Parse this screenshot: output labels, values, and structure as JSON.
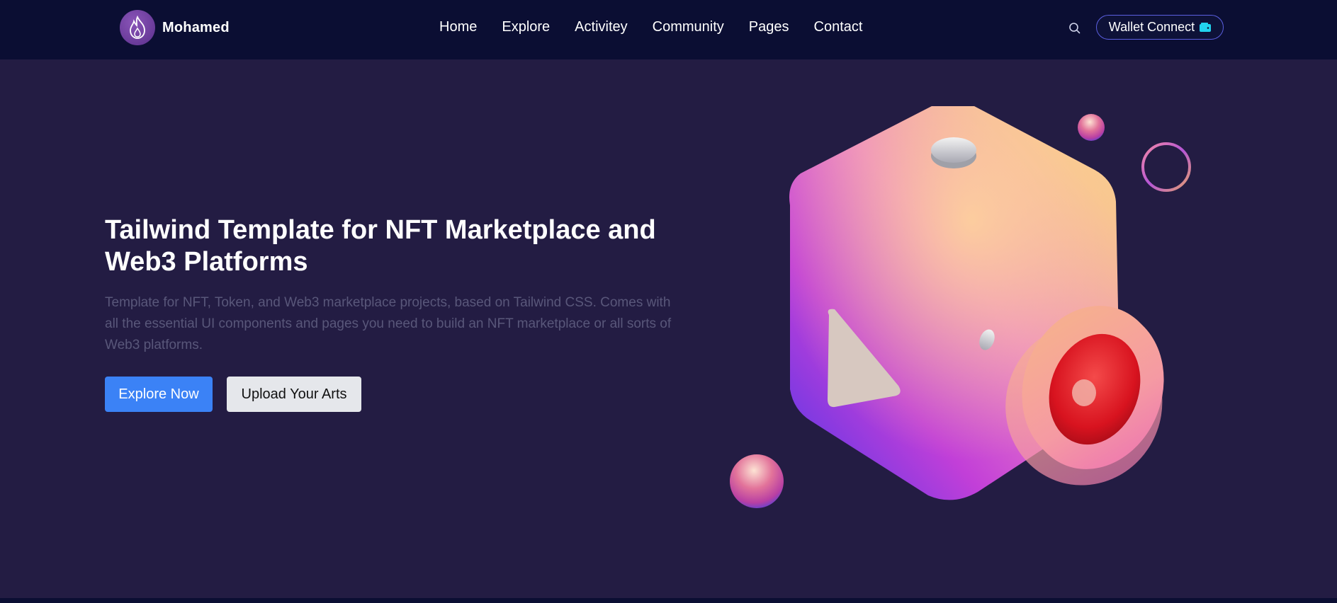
{
  "brand": {
    "name": "Mohamed",
    "logo_icon": "flame-icon"
  },
  "nav": {
    "links": [
      "Home",
      "Explore",
      "Activitey",
      "Community",
      "Pages",
      "Contact"
    ],
    "search_icon": "search-icon",
    "wallet_button": {
      "label": "Wallet Connect",
      "icon": "wallet-icon"
    }
  },
  "hero": {
    "title": "Tailwind Template for NFT Marketplace and Web3 Platforms",
    "description": "Template for NFT, Token, and Web3 marketplace projects, based on Tailwind CSS. Comes with all the essential UI components and pages you need to build an NFT marketplace or all sorts of Web3 platforms.",
    "primary_button": "Explore Now",
    "secondary_button": "Upload Your Arts",
    "illustration": "3d-cube-speaker-illustration"
  },
  "colors": {
    "navbar_bg": "#0b0e33",
    "page_bg": "#231c43",
    "primary": "#3b82f6",
    "description_text": "#59577a"
  }
}
